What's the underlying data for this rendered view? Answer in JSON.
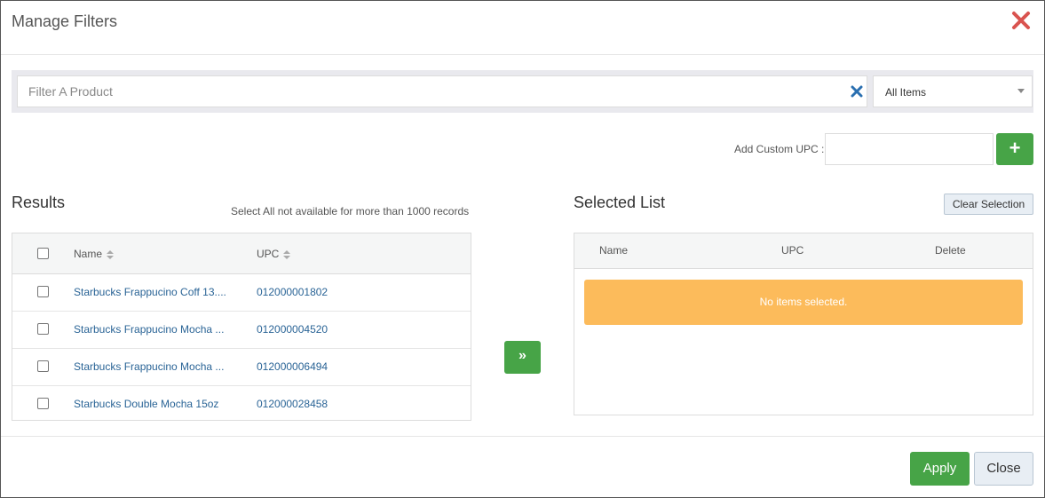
{
  "modal": {
    "title": "Manage Filters"
  },
  "filter": {
    "placeholder": "Filter A Product",
    "value": "",
    "type_selected": "All Items"
  },
  "custom_upc": {
    "label": "Add Custom UPC :",
    "value": "",
    "add_label": "+"
  },
  "results": {
    "title": "Results",
    "note": "Select All not available for more than 1000 records",
    "columns": {
      "name": "Name",
      "upc": "UPC"
    },
    "rows": [
      {
        "name": "Starbucks Frappucino Coff 13....",
        "upc": "012000001802"
      },
      {
        "name": "Starbucks Frappucino Mocha ...",
        "upc": "012000004520"
      },
      {
        "name": "Starbucks Frappucino Mocha ...",
        "upc": "012000006494"
      },
      {
        "name": "Starbucks Double Mocha 15oz",
        "upc": "012000028458"
      }
    ]
  },
  "move_button": {
    "label": "»"
  },
  "selected": {
    "title": "Selected List",
    "clear_label": "Clear Selection",
    "columns": {
      "name": "Name",
      "upc": "UPC",
      "delete": "Delete"
    },
    "empty_message": "No items selected."
  },
  "footer": {
    "apply_label": "Apply",
    "close_label": "Close"
  },
  "colors": {
    "primary_green": "#47a447",
    "warning_orange": "#fcbb5b",
    "close_red": "#d9534f",
    "link_blue": "#2a6496"
  }
}
